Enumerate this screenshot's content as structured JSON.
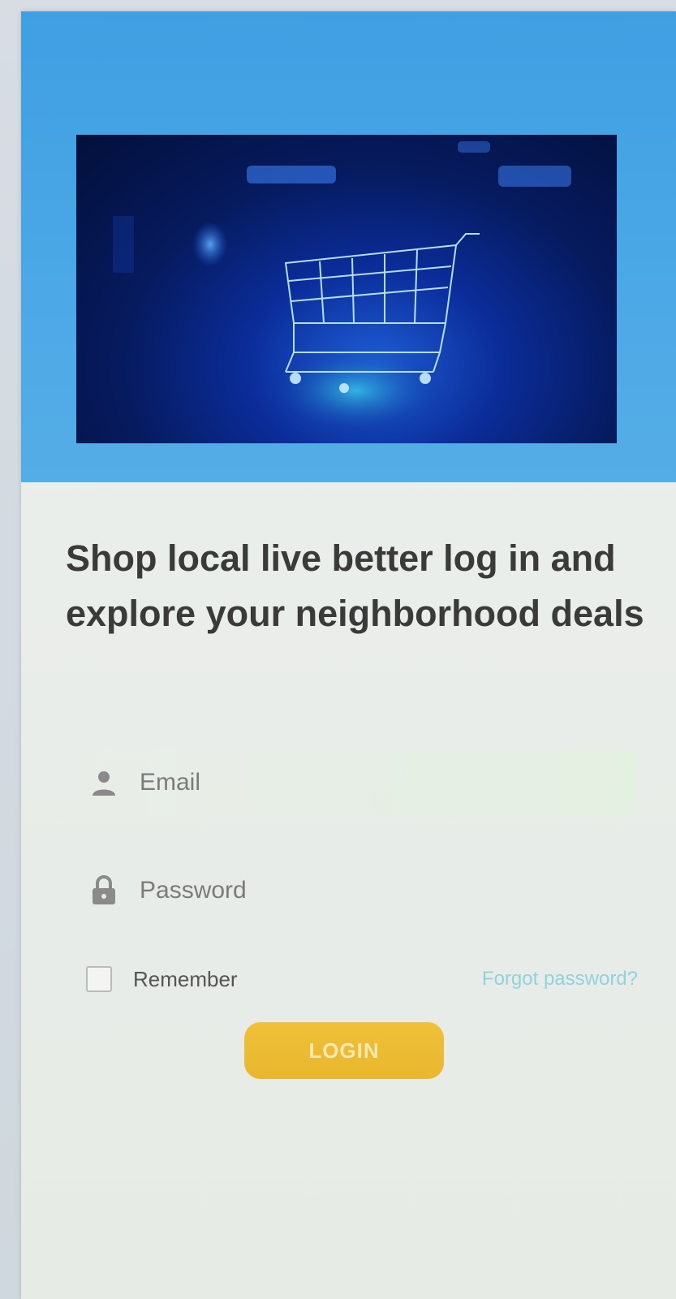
{
  "hero": {
    "image_subject": "shopping-cart-image"
  },
  "headline": "Shop local live better log in and explore your neighborhood deals",
  "form": {
    "email_placeholder": "Email",
    "password_placeholder": "Password",
    "remember_label": "Remember",
    "forgot_password_label": "Forgot password?",
    "login_label": "LOGIN"
  },
  "icons": {
    "email": "user-icon",
    "password": "lock-icon",
    "hero": "shopping-cart-icon"
  },
  "colors": {
    "hero_background": "#4aa7e6",
    "login_button": "#ecbb33",
    "link": "#8fd3dd",
    "headline_text": "#3a3a3a"
  }
}
